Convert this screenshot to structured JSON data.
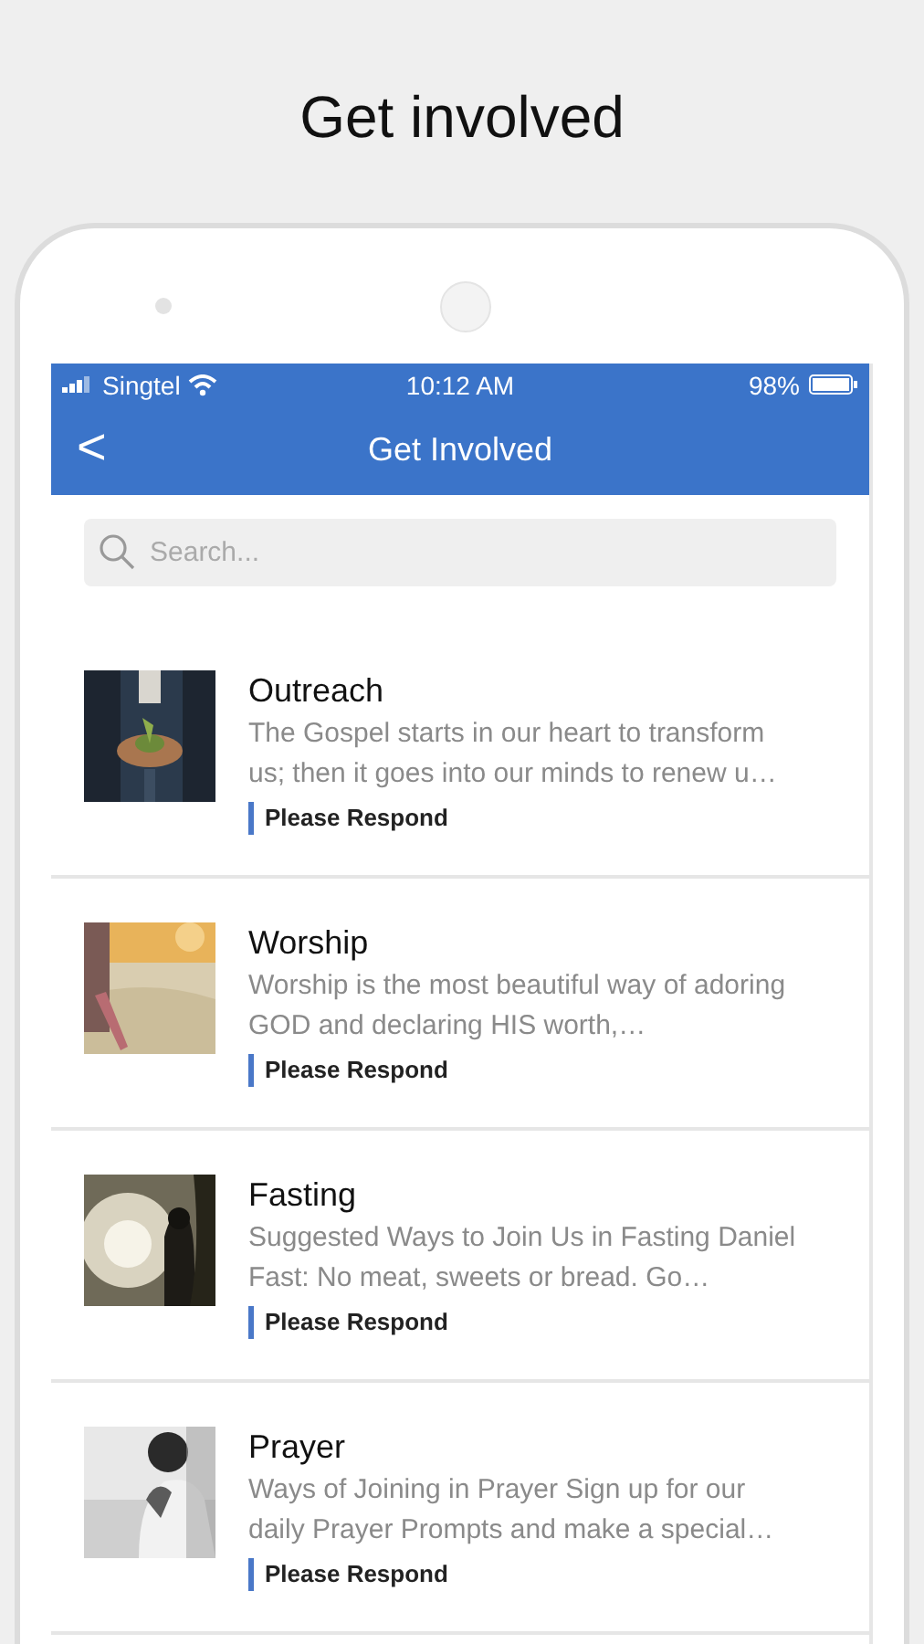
{
  "headline": "Get involved",
  "status_bar": {
    "carrier": "Singtel",
    "time": "10:12 AM",
    "battery": "98%"
  },
  "nav": {
    "back": "<",
    "title": "Get Involved"
  },
  "search": {
    "placeholder": "Search..."
  },
  "items": [
    {
      "title": "Outreach",
      "description": "The Gospel starts in our heart to transform us; then it goes into our minds to renew u…",
      "action": "Please Respond",
      "kind": "hands"
    },
    {
      "title": "Worship",
      "description": "Worship is the most beautiful way of adoring GOD and declaring HIS worth,…",
      "action": "Please Respond",
      "kind": "field"
    },
    {
      "title": "Fasting",
      "description": "Suggested Ways to Join Us in Fasting Daniel Fast: No meat, sweets or bread. Go…",
      "action": "Please Respond",
      "kind": "sunlight"
    },
    {
      "title": "Prayer",
      "description": "Ways of Joining in Prayer Sign up for our daily Prayer Prompts and make a special…",
      "action": "Please Respond",
      "kind": "mono"
    }
  ]
}
